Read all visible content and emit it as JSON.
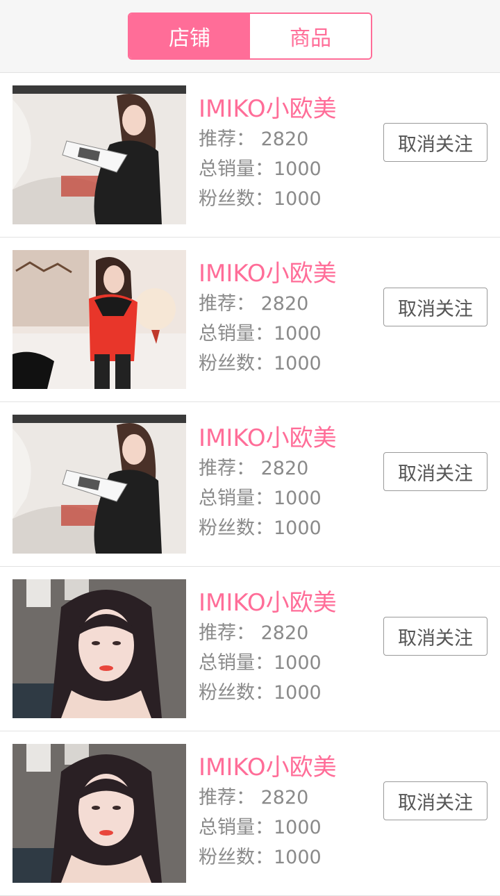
{
  "tabs": {
    "shop_label": "店铺",
    "product_label": "商品",
    "active": "shop"
  },
  "stores": [
    {
      "name": "IMIKO小欧美",
      "recommend": "推荐： 2820",
      "sales": "总销量：1000",
      "fans": "粉丝数：1000",
      "button": "取消关注",
      "photo": "woman-reading-magazine-black-dress"
    },
    {
      "name": "IMIKO小欧美",
      "recommend": "推荐： 2820",
      "sales": "总销量：1000",
      "fans": "粉丝数：1000",
      "button": "取消关注",
      "photo": "woman-red-coat-christmas"
    },
    {
      "name": "IMIKO小欧美",
      "recommend": "推荐： 2820",
      "sales": "总销量：1000",
      "fans": "粉丝数：1000",
      "button": "取消关注",
      "photo": "woman-reading-magazine-black-dress"
    },
    {
      "name": "IMIKO小欧美",
      "recommend": "推荐： 2820",
      "sales": "总销量：1000",
      "fans": "粉丝数：1000",
      "button": "取消关注",
      "photo": "woman-portrait-long-hair"
    },
    {
      "name": "IMIKO小欧美",
      "recommend": "推荐： 2820",
      "sales": "总销量：1000",
      "fans": "粉丝数：1000",
      "button": "取消关注",
      "photo": "woman-portrait-long-hair"
    }
  ],
  "colors": {
    "accent": "#ff6d98",
    "stat_text": "#8a8a8a",
    "button_border": "#999999"
  }
}
